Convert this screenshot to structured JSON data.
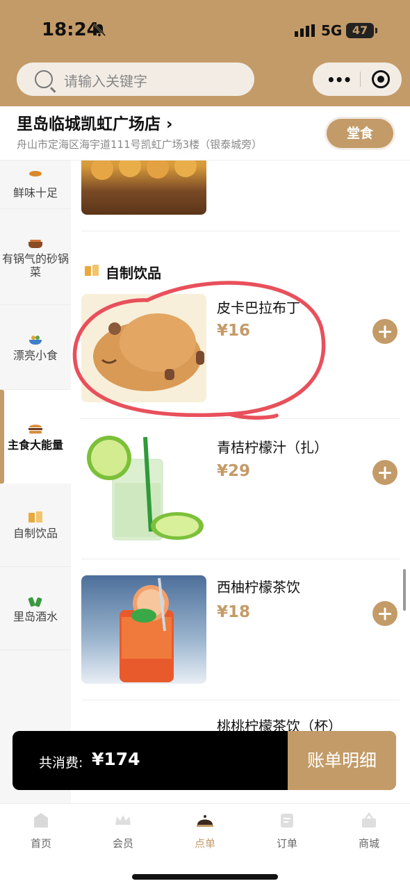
{
  "status_bar": {
    "time": "18:24",
    "network": "5G",
    "battery": "47"
  },
  "search": {
    "placeholder": "请输入关键字"
  },
  "capsule": {
    "more": "•••"
  },
  "store": {
    "name": "里岛临城凯虹广场店 ›",
    "address": "舟山市定海区海宇道111号凯虹广场3楼（银泰城旁）",
    "mode_button": "堂食"
  },
  "sidebar": {
    "items": [
      {
        "label": "鲜味十足",
        "icon": "seafood-icon"
      },
      {
        "label": "有锅气的砂锅菜",
        "icon": "claypot-icon"
      },
      {
        "label": "漂亮小食",
        "icon": "snack-icon"
      },
      {
        "label": "主食大能量",
        "icon": "burger-icon",
        "active": true
      },
      {
        "label": "自制饮品",
        "icon": "drink-icon"
      },
      {
        "label": "里岛酒水",
        "icon": "bottle-icon"
      }
    ]
  },
  "menu": {
    "section_title": "自制饮品",
    "products": [
      {
        "name": "皮卡巴拉布丁",
        "price": "¥16"
      },
      {
        "name": "青桔柠檬汁（扎）",
        "price": "¥29"
      },
      {
        "name": "西柚柠檬茶饮",
        "price": "¥18"
      },
      {
        "name": "桃桃柠檬茶饮（杯）",
        "price": ""
      }
    ]
  },
  "cart": {
    "label": "共消费:",
    "total": "¥174",
    "button": "账单明细"
  },
  "tabbar": {
    "tabs": [
      {
        "label": "首页",
        "icon": "home-icon"
      },
      {
        "label": "会员",
        "icon": "crown-icon"
      },
      {
        "label": "点单",
        "icon": "cloche-icon",
        "active": true
      },
      {
        "label": "订单",
        "icon": "order-icon"
      },
      {
        "label": "商城",
        "icon": "basket-icon"
      }
    ]
  },
  "colors": {
    "brand": "#c39b68",
    "annotation": "#e8505b"
  }
}
